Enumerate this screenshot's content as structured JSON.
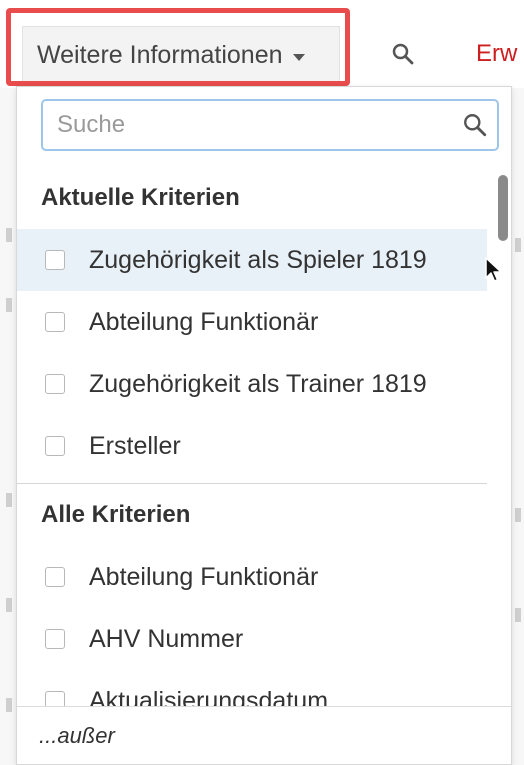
{
  "toolbar": {
    "more_label": "Weitere Informationen",
    "partial_label": "Erw"
  },
  "dropdown": {
    "search_placeholder": "Suche",
    "current_section": {
      "title": "Aktuelle Kriterien",
      "items": [
        {
          "label": "Zugehörigkeit als Spieler 1819",
          "checked": false,
          "hovered": true
        },
        {
          "label": "Abteilung Funktionär",
          "checked": false
        },
        {
          "label": "Zugehörigkeit als Trainer 1819",
          "checked": false
        },
        {
          "label": "Ersteller",
          "checked": false
        }
      ]
    },
    "all_section": {
      "title": "Alle Kriterien",
      "items": [
        {
          "label": "Abteilung Funktionär",
          "checked": false
        },
        {
          "label": "AHV Nummer",
          "checked": false
        },
        {
          "label": "Aktualisierungsdatum",
          "checked": false
        }
      ]
    },
    "footer_label": "...außer"
  },
  "colors": {
    "highlight_border": "#e84c4c",
    "search_focus_border": "#9ec6e8",
    "hover_row": "#e9f1f8",
    "link_red": "#cc1f1f"
  },
  "icons": {
    "toolbar_search": "search-icon",
    "field_search": "search-icon",
    "caret": "caret-down-icon",
    "cursor": "mouse-pointer-icon"
  }
}
